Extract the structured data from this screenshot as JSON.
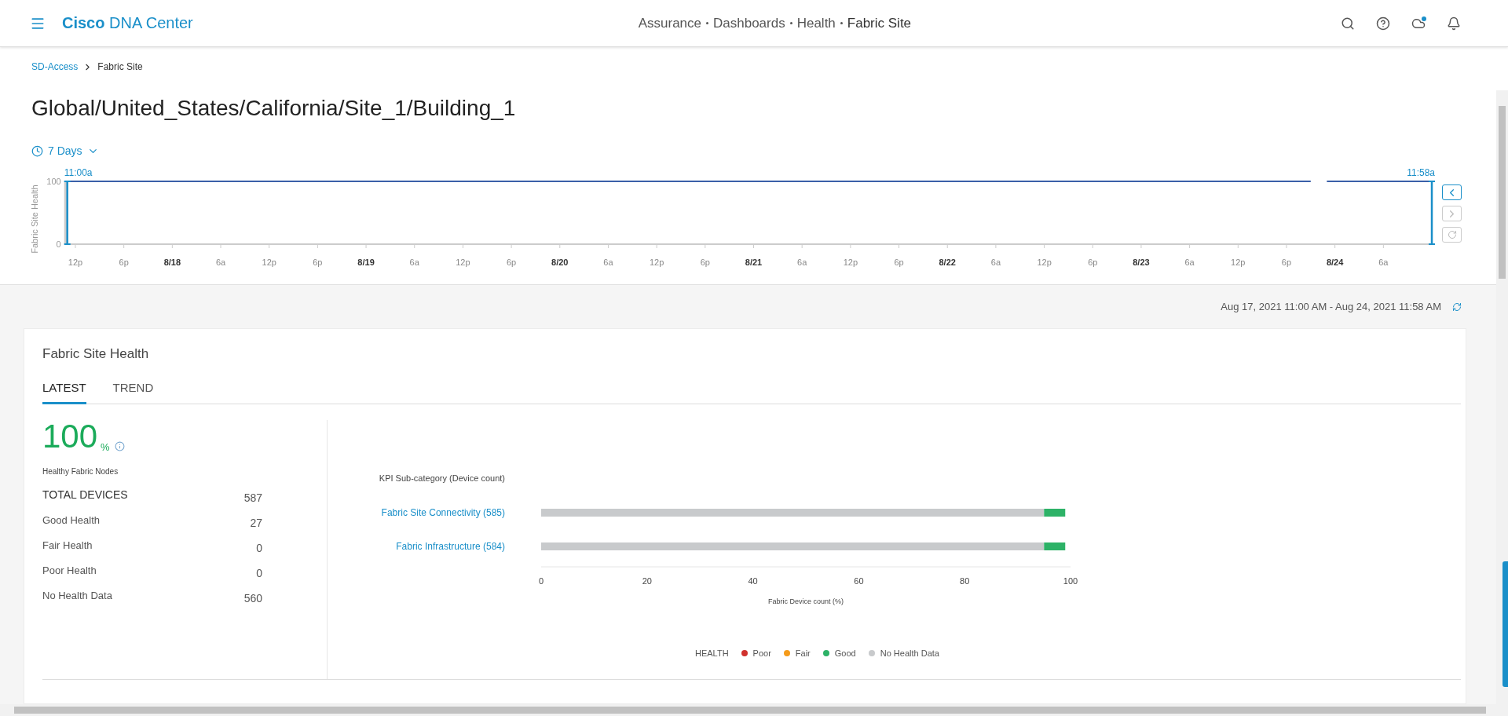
{
  "header": {
    "logo": "**Cisco** DNA Center",
    "breadcrumb": [
      "Assurance",
      "Dashboards",
      "Health",
      "Fabric Site"
    ]
  },
  "nav": {
    "breadcrumb": [
      {
        "label": "SD-Access",
        "kind": "link"
      },
      {
        "label": "Fabric Site",
        "kind": "current"
      }
    ]
  },
  "page_title": "Global/United_States/California/Site_1/Building_1",
  "time_range": {
    "label": "7 Days"
  },
  "timeline": {
    "chart_data": {
      "type": "line",
      "ylabel": "Fabric Site Health",
      "categories": [
        null,
        "12p",
        null,
        null,
        null,
        null,
        null,
        "6p",
        null,
        null,
        null,
        null,
        null,
        "8/18",
        null,
        null,
        null,
        null,
        null,
        "6a",
        null,
        null,
        null,
        null,
        null,
        "12p",
        null,
        null,
        null,
        null,
        null,
        "6p",
        null,
        null,
        null,
        null,
        null,
        "8/19",
        null,
        null,
        null,
        null,
        null,
        "6a",
        null,
        null,
        null,
        null,
        null,
        "12p",
        null,
        null,
        null,
        null,
        null,
        "6p",
        null,
        null,
        null,
        null,
        null,
        "8/20",
        null,
        null,
        null,
        null,
        null,
        "6a",
        null,
        null,
        null,
        null,
        null,
        "12p",
        null,
        null,
        null,
        null,
        null,
        "6p",
        null,
        null,
        null,
        null,
        null,
        "8/21",
        null,
        null,
        null,
        null,
        null,
        "6a",
        null,
        null,
        null,
        null,
        null,
        "12p",
        null,
        null,
        null,
        null,
        null,
        "6p",
        null,
        null,
        null,
        null,
        null,
        "8/22",
        null,
        null,
        null,
        null,
        null,
        "6a",
        null,
        null,
        null,
        null,
        null,
        "12p",
        null,
        null,
        null,
        null,
        null,
        "6p",
        null,
        null,
        null,
        null,
        null,
        "8/23",
        null,
        null,
        null,
        null,
        null,
        "6a",
        null,
        null,
        null,
        null,
        null,
        "12p",
        null,
        null,
        null,
        null,
        null,
        "6p",
        null,
        null,
        null,
        null,
        null,
        "8/24",
        null,
        null,
        null,
        null,
        null,
        "6a",
        null,
        null,
        null,
        null,
        null,
        null
      ],
      "series": [
        {
          "color": "#3a5fa8",
          "values": [
            100,
            100,
            100,
            100,
            100,
            100,
            100,
            100,
            100,
            100,
            100,
            100,
            100,
            100,
            100,
            100,
            100,
            100,
            100,
            100,
            100,
            100,
            100,
            100,
            100,
            100,
            100,
            100,
            100,
            100,
            100,
            100,
            100,
            100,
            100,
            100,
            100,
            100,
            100,
            100,
            100,
            100,
            100,
            100,
            100,
            100,
            100,
            100,
            100,
            100,
            100,
            100,
            100,
            100,
            100,
            100,
            100,
            100,
            100,
            100,
            100,
            100,
            100,
            100,
            100,
            100,
            100,
            100,
            100,
            100,
            100,
            100,
            100,
            100,
            100,
            100,
            100,
            100,
            100,
            100,
            100,
            100,
            100,
            100,
            100,
            100,
            100,
            100,
            100,
            100,
            100,
            100,
            100,
            100,
            100,
            100,
            100,
            100,
            100,
            100,
            100,
            100,
            100,
            100,
            100,
            100,
            100,
            100,
            100,
            100,
            100,
            100,
            100,
            100,
            100,
            100,
            100,
            100,
            100,
            100,
            100,
            100,
            100,
            100,
            100,
            100,
            100,
            100,
            100,
            100,
            100,
            100,
            100,
            100,
            100,
            100,
            100,
            100,
            100,
            100,
            100,
            100,
            100,
            100,
            100,
            100,
            100,
            100,
            100,
            100,
            100,
            100,
            100,
            100,
            100,
            null,
            100,
            100,
            100,
            100,
            100,
            100,
            100,
            100,
            100,
            100,
            100,
            100,
            100,
            100
          ]
        }
      ],
      "ylim": [
        0,
        100
      ],
      "yticks": [
        0,
        100
      ],
      "annotations": [
        {
          "y": 100,
          "text": "11:00a"
        },
        {
          "y": 100,
          "text": "11:58a"
        }
      ]
    },
    "nav_buttons": [
      {
        "kind": "previous",
        "disabled": false
      },
      {
        "kind": "next",
        "disabled": true
      },
      {
        "kind": "reset",
        "disabled": true
      }
    ]
  },
  "date_range": "Aug 17, 2021 11:00 AM - Aug 24, 2021 11:58 AM",
  "health_card": {
    "title": "Fabric Site Health",
    "tabs": [
      {
        "label": "LATEST",
        "selected": true
      },
      {
        "label": "TREND",
        "selected": false
      }
    ],
    "score": "100",
    "score_unit": "%",
    "score_label": "Healthy Fabric Nodes",
    "stats": [
      {
        "kind": "total",
        "label": "TOTAL DEVICES",
        "value": "587"
      },
      {
        "kind": "row",
        "label": "Good Health",
        "value": "27"
      },
      {
        "kind": "row",
        "label": "Fair Health",
        "value": "0"
      },
      {
        "kind": "row",
        "label": "Poor Health",
        "value": "0"
      },
      {
        "kind": "row",
        "label": "No Health Data",
        "value": "560"
      }
    ],
    "chart_data": {
      "type": "bar",
      "orientation": "horizontal",
      "stacked": true,
      "ylabel": "KPI Sub-category (Device count)",
      "xlabel": "Fabric Device count (%)",
      "categories": [
        "Fabric Site Connectivity (585)",
        "Fabric Infrastructure (584)"
      ],
      "series": [
        {
          "name": "Poor",
          "color": "#d0312d",
          "values": [
            0,
            0
          ]
        },
        {
          "name": "Fair",
          "color": "#f59b1b",
          "values": [
            0,
            0
          ]
        },
        {
          "name": "Good",
          "color": "#2db267",
          "values": [
            4,
            4
          ]
        },
        {
          "name": "No Health Data",
          "color": "#c8cacc",
          "values": [
            95,
            95
          ]
        }
      ],
      "xlim": [
        0,
        100
      ],
      "xticks": [
        0,
        20,
        40,
        60,
        80,
        100
      ]
    },
    "legend_title": "HEALTH"
  }
}
